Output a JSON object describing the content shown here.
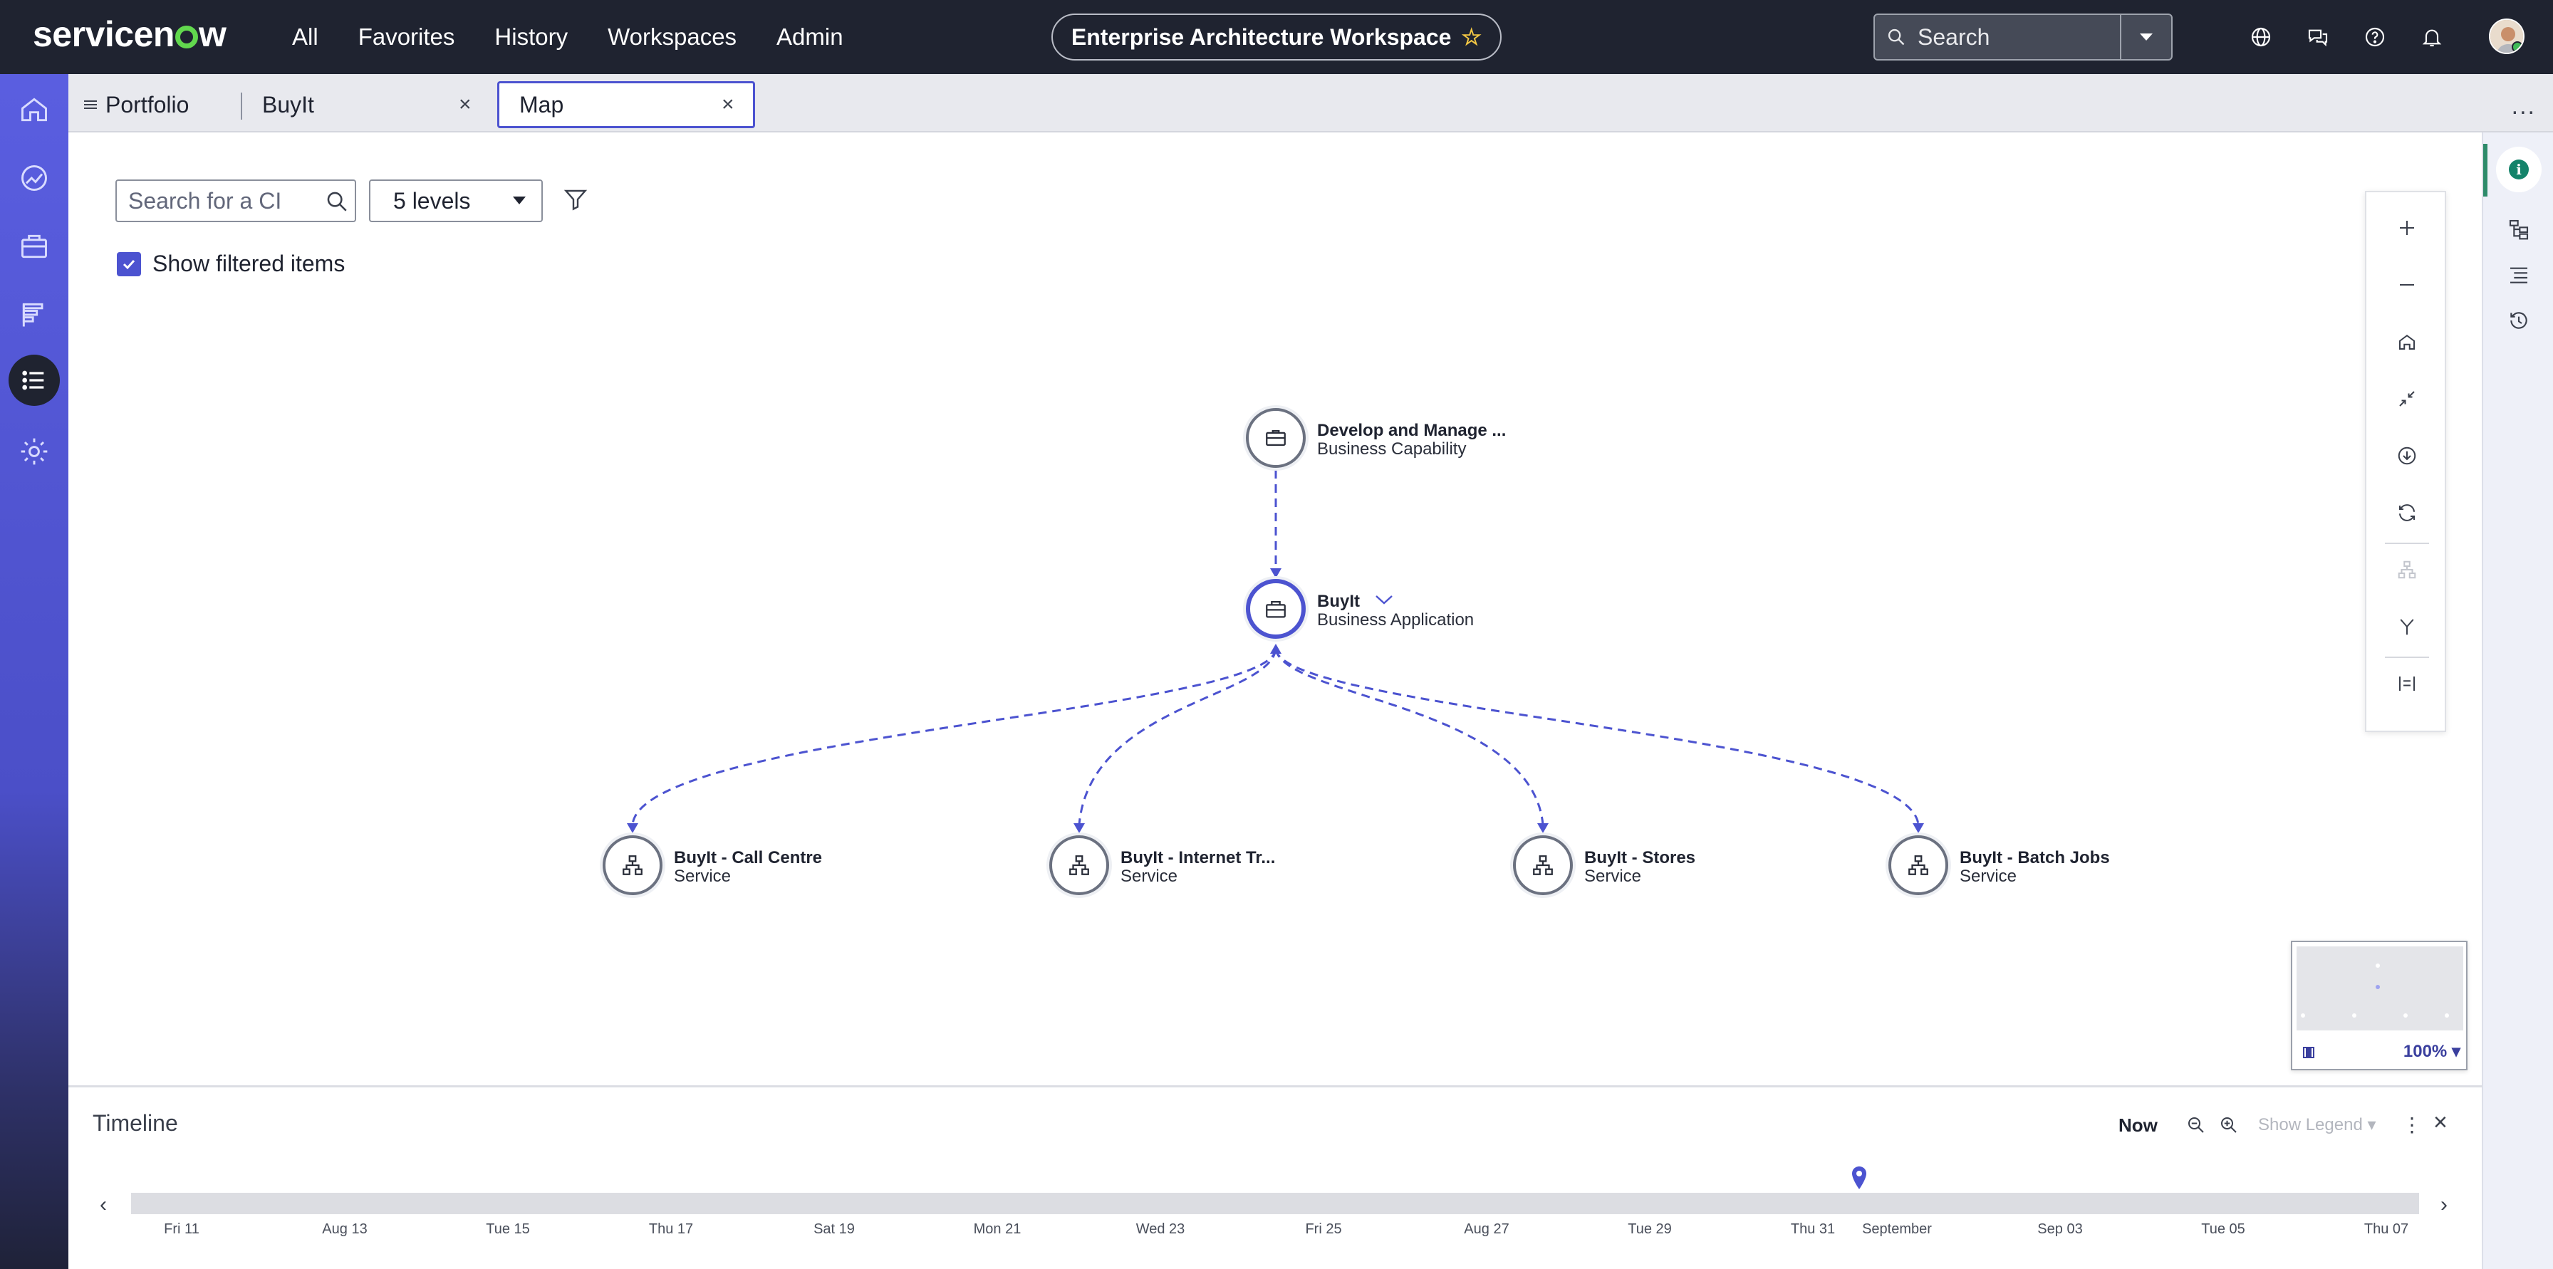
{
  "header": {
    "logo": "servicenow",
    "nav": [
      "All",
      "Favorites",
      "History",
      "Workspaces",
      "Admin"
    ],
    "workspace_title": "Enterprise Architecture Workspace",
    "search_placeholder": "Search"
  },
  "tabs": {
    "portfolio_label": "Portfolio",
    "items": [
      {
        "label": "BuyIt",
        "active": false
      },
      {
        "label": "Map",
        "active": true
      }
    ],
    "close_glyph": "×",
    "more": "..."
  },
  "toolbar": {
    "ci_search_placeholder": "Search for a CI",
    "levels_value": "5 levels",
    "show_filtered_label": "Show filtered items",
    "show_filtered_checked": true
  },
  "map": {
    "nodes": [
      {
        "id": "capability",
        "name": "Develop and Manage ...",
        "type": "Business Capability",
        "icon": "briefcase-closed-icon"
      },
      {
        "id": "app",
        "name": "BuyIt",
        "type": "Business Application",
        "icon": "briefcase-icon",
        "focused": true
      },
      {
        "id": "svc1",
        "name": "BuyIt - Call Centre",
        "type": "Service",
        "icon": "service-hierarchy-icon"
      },
      {
        "id": "svc2",
        "name": "BuyIt - Internet Tr...",
        "type": "Service",
        "icon": "service-hierarchy-icon"
      },
      {
        "id": "svc3",
        "name": "BuyIt - Stores",
        "type": "Service",
        "icon": "service-hierarchy-icon"
      },
      {
        "id": "svc4",
        "name": "BuyIt - Batch Jobs",
        "type": "Service",
        "icon": "service-hierarchy-icon"
      }
    ],
    "edge_color": "#4c53d0",
    "minimap_zoom": "100%"
  },
  "timeline": {
    "title": "Timeline",
    "now_label": "Now",
    "legend_label": "Show Legend",
    "ticks": [
      "Fri 11",
      "Aug 13",
      "Tue 15",
      "Thu 17",
      "Sat 19",
      "Mon 21",
      "Wed 23",
      "Fri 25",
      "Aug 27",
      "Tue 29",
      "Thu 31",
      "September",
      "Sep 03",
      "Tue 05",
      "Thu 07"
    ]
  },
  "colors": {
    "accent": "#4c53d0",
    "header_bg": "#1f2330",
    "rail_gradient_top": "#5a5ee0",
    "info_green": "#14836a",
    "logo_green": "#62d84e"
  }
}
